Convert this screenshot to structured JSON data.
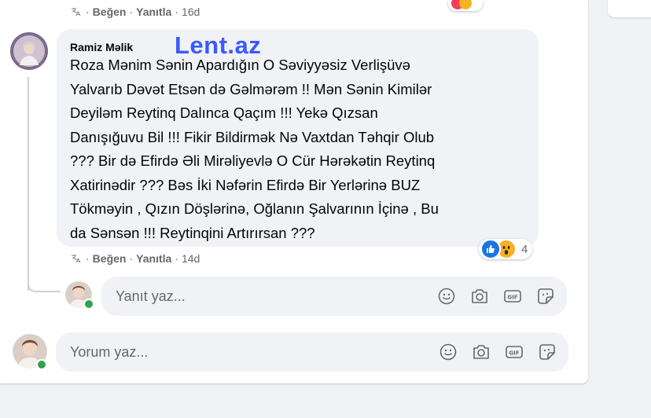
{
  "top_actions": {
    "like": "Beğen",
    "reply": "Yanıtla",
    "time": "16d"
  },
  "comment": {
    "author": "Ramiz Məlik",
    "watermark": "Lent.az",
    "lines": [
      "Roza Mənim Sənin Apardığın O Səviyyəsiz Verlişüvə",
      "Yalvarıb Dəvət Etsən də Gəlmərəm !! Mən Sənin Kimilər",
      "Deyiləm Reytinq Dalınca Qaçım !!! Yekə Qızsan",
      "Danışığuvu Bil !!! Fikir Bildirmək Nə Vaxtdan Təhqir Olub",
      "??? Bir də Efirdə Əli Mirəliyevlə O Cür Hərəkətin Reytinq",
      "Xatirinədir ??? Bəs İki Nəfərin Efirdə Bir Yerlərinə BUZ",
      "Tökməyin , Qızın Döşlərinə, Oğlanın Şalvarının İçinə , Bu",
      "da Sənsən !!! Reytinqini Artırırsan ???"
    ],
    "reaction_count": "4",
    "reactions": [
      "like-icon",
      "wow-icon"
    ]
  },
  "comment_actions": {
    "like": "Beğen",
    "reply": "Yanıtla",
    "time": "14d"
  },
  "reply_input": {
    "placeholder": "Yanıt yaz..."
  },
  "comment_input": {
    "placeholder": "Yorum yaz..."
  },
  "toolbar_icons": [
    "emoji-icon",
    "camera-icon",
    "gif-icon",
    "sticker-icon"
  ],
  "colors": {
    "bubble": "#f0f2f5",
    "watermark": "#3b59ff",
    "like_blue": "#1b74e4",
    "online_green": "#31a24c",
    "muted_text": "#65676b"
  }
}
